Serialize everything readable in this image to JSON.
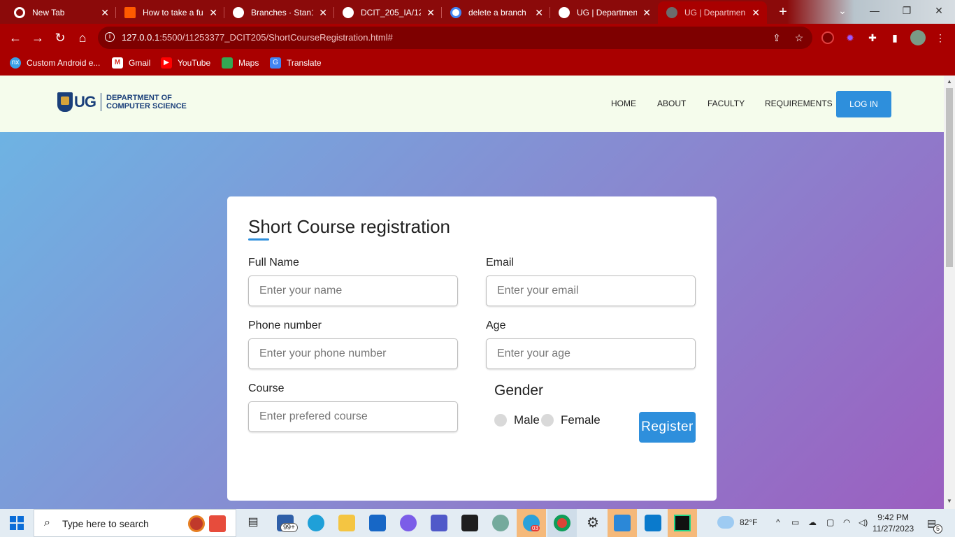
{
  "browser": {
    "tabs": [
      {
        "title": "New Tab",
        "icon": "chrome-icon",
        "color": "#ffffff",
        "active": false
      },
      {
        "title": "How to take a fu",
        "icon": "orange-square-icon",
        "color": "#ff5a00",
        "active": false
      },
      {
        "title": "Branches · Stan1",
        "icon": "github-icon",
        "color": "#ffffff",
        "active": false
      },
      {
        "title": "DCIT_205_IA/12",
        "icon": "github-icon",
        "color": "#ffffff",
        "active": false
      },
      {
        "title": "delete a branch",
        "icon": "google-icon",
        "color": "#ffffff",
        "active": false
      },
      {
        "title": "UG | Departmen",
        "icon": "globe-icon",
        "color": "#ffffff",
        "active": false
      },
      {
        "title": "UG | Departmen",
        "icon": "globe-icon",
        "color": "#6c6c6c",
        "active": true
      }
    ],
    "url_host": "127.0.0.1",
    "url_path": ":5500/11253377_DCIT205/ShortCourseRegistration.html#",
    "bookmarks": [
      {
        "label": "Custom Android e...",
        "icon": "nox-icon"
      },
      {
        "label": "Gmail",
        "icon": "gmail-icon"
      },
      {
        "label": "YouTube",
        "icon": "youtube-icon"
      },
      {
        "label": "Maps",
        "icon": "maps-icon"
      },
      {
        "label": "Translate",
        "icon": "translate-icon"
      }
    ]
  },
  "site": {
    "logo_text": "UG",
    "dept_line1": "DEPARTMENT OF",
    "dept_line2": "COMPUTER SCIENCE",
    "nav": [
      "HOME",
      "ABOUT",
      "FACULTY",
      "REQUIREMENTS"
    ],
    "login_label": "LOG IN"
  },
  "form": {
    "title": "Short Course registration",
    "fields": {
      "name": {
        "label": "Full Name",
        "placeholder": "Enter your name"
      },
      "email": {
        "label": "Email",
        "placeholder": "Enter your email"
      },
      "phone": {
        "label": "Phone number",
        "placeholder": "Enter your phone number"
      },
      "age": {
        "label": "Age",
        "placeholder": "Enter your age"
      },
      "course": {
        "label": "Course",
        "placeholder": "Enter prefered course"
      }
    },
    "gender_title": "Gender",
    "gender_options": [
      "Male",
      "Female"
    ],
    "register_label": "Register"
  },
  "taskbar": {
    "search_placeholder": "Type here to search",
    "mail_badge": "99+",
    "telegram_badge": "03",
    "weather": "82°F",
    "time": "9:42 PM",
    "date": "11/27/2023",
    "notification_count": "5"
  },
  "colors": {
    "chrome_theme": "#a90000",
    "accent": "#2e8fdc",
    "navbar_bg": "#f5fcec"
  }
}
